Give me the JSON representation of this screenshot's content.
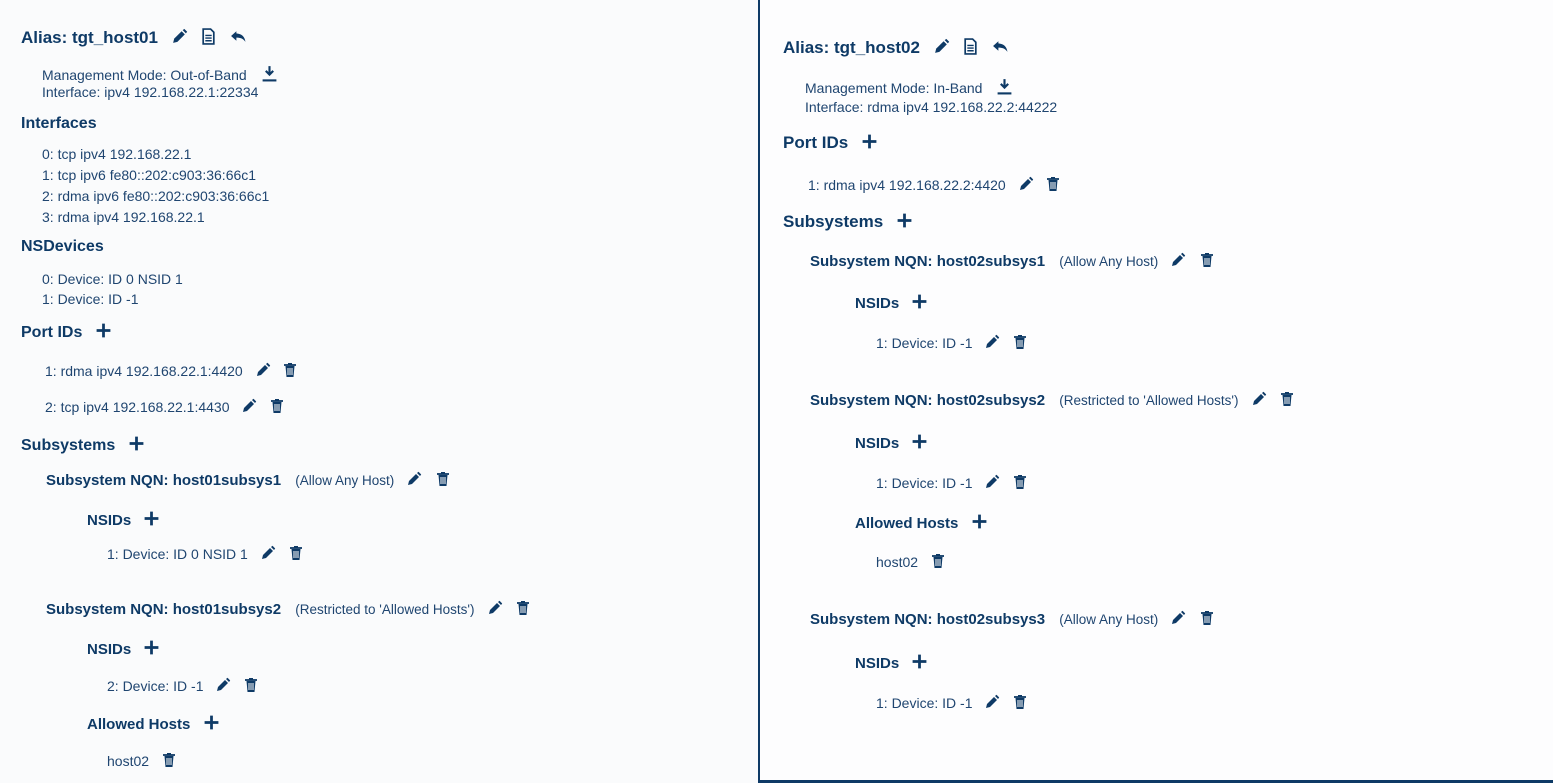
{
  "left": {
    "alias": "Alias: tgt_host01",
    "mgmt_mode": "Management Mode: Out-of-Band",
    "interface": "Interface: ipv4 192.168.22.1:22334",
    "interfaces_heading": "Interfaces",
    "interfaces": [
      "0:  tcp ipv4 192.168.22.1",
      "1:  tcp ipv6 fe80::202:c903:36:66c1",
      "2:  rdma ipv6 fe80::202:c903:36:66c1",
      "3:  rdma ipv4 192.168.22.1"
    ],
    "nsdevices_heading": "NSDevices",
    "nsdevices": [
      "0: Device:  ID 0   NSID 1",
      "1: Device:  ID -1"
    ],
    "portids_heading": "Port IDs",
    "portids": [
      "1:  rdma ipv4 192.168.22.1:4420",
      "2:  tcp ipv4 192.168.22.1:4430"
    ],
    "subsystems_heading": "Subsystems",
    "subsystems": [
      {
        "nqn": "Subsystem NQN: host01subsys1",
        "access": "(Allow Any Host)",
        "nsids_heading": "NSIDs",
        "nsids": [
          "1:  Device: ID 0  NSID 1"
        ]
      },
      {
        "nqn": "Subsystem NQN: host01subsys2",
        "access": "(Restricted to 'Allowed Hosts')",
        "nsids_heading": "NSIDs",
        "nsids": [
          "2:  Device: ID -1"
        ],
        "allowed_hosts_heading": "Allowed Hosts",
        "allowed_hosts": [
          "host02"
        ]
      }
    ]
  },
  "right": {
    "alias": "Alias: tgt_host02",
    "mgmt_mode": "Management Mode: In-Band",
    "interface": "Interface: rdma ipv4 192.168.22.2:44222",
    "portids_heading": "Port IDs",
    "portids": [
      "1:  rdma ipv4 192.168.22.2:4420"
    ],
    "subsystems_heading": "Subsystems",
    "subsystems": [
      {
        "nqn": "Subsystem NQN: host02subsys1",
        "access": "(Allow Any Host)",
        "nsids_heading": "NSIDs",
        "nsids": [
          "1:  Device: ID -1"
        ]
      },
      {
        "nqn": "Subsystem NQN: host02subsys2",
        "access": "(Restricted to 'Allowed Hosts')",
        "nsids_heading": "NSIDs",
        "nsids": [
          "1:  Device: ID -1"
        ],
        "allowed_hosts_heading": "Allowed Hosts",
        "allowed_hosts": [
          "host02"
        ]
      },
      {
        "nqn": "Subsystem NQN: host02subsys3",
        "access": "(Allow Any Host)",
        "nsids_heading": "NSIDs",
        "nsids": [
          "1:  Device: ID -1"
        ]
      }
    ]
  },
  "icons": {
    "edit": "pencil-icon",
    "details": "document-icon",
    "back": "undo-icon",
    "download": "download-icon",
    "add": "plus-icon",
    "delete": "trash-icon"
  },
  "colors": {
    "text": "#0e3a66",
    "border": "#0e3a66"
  }
}
